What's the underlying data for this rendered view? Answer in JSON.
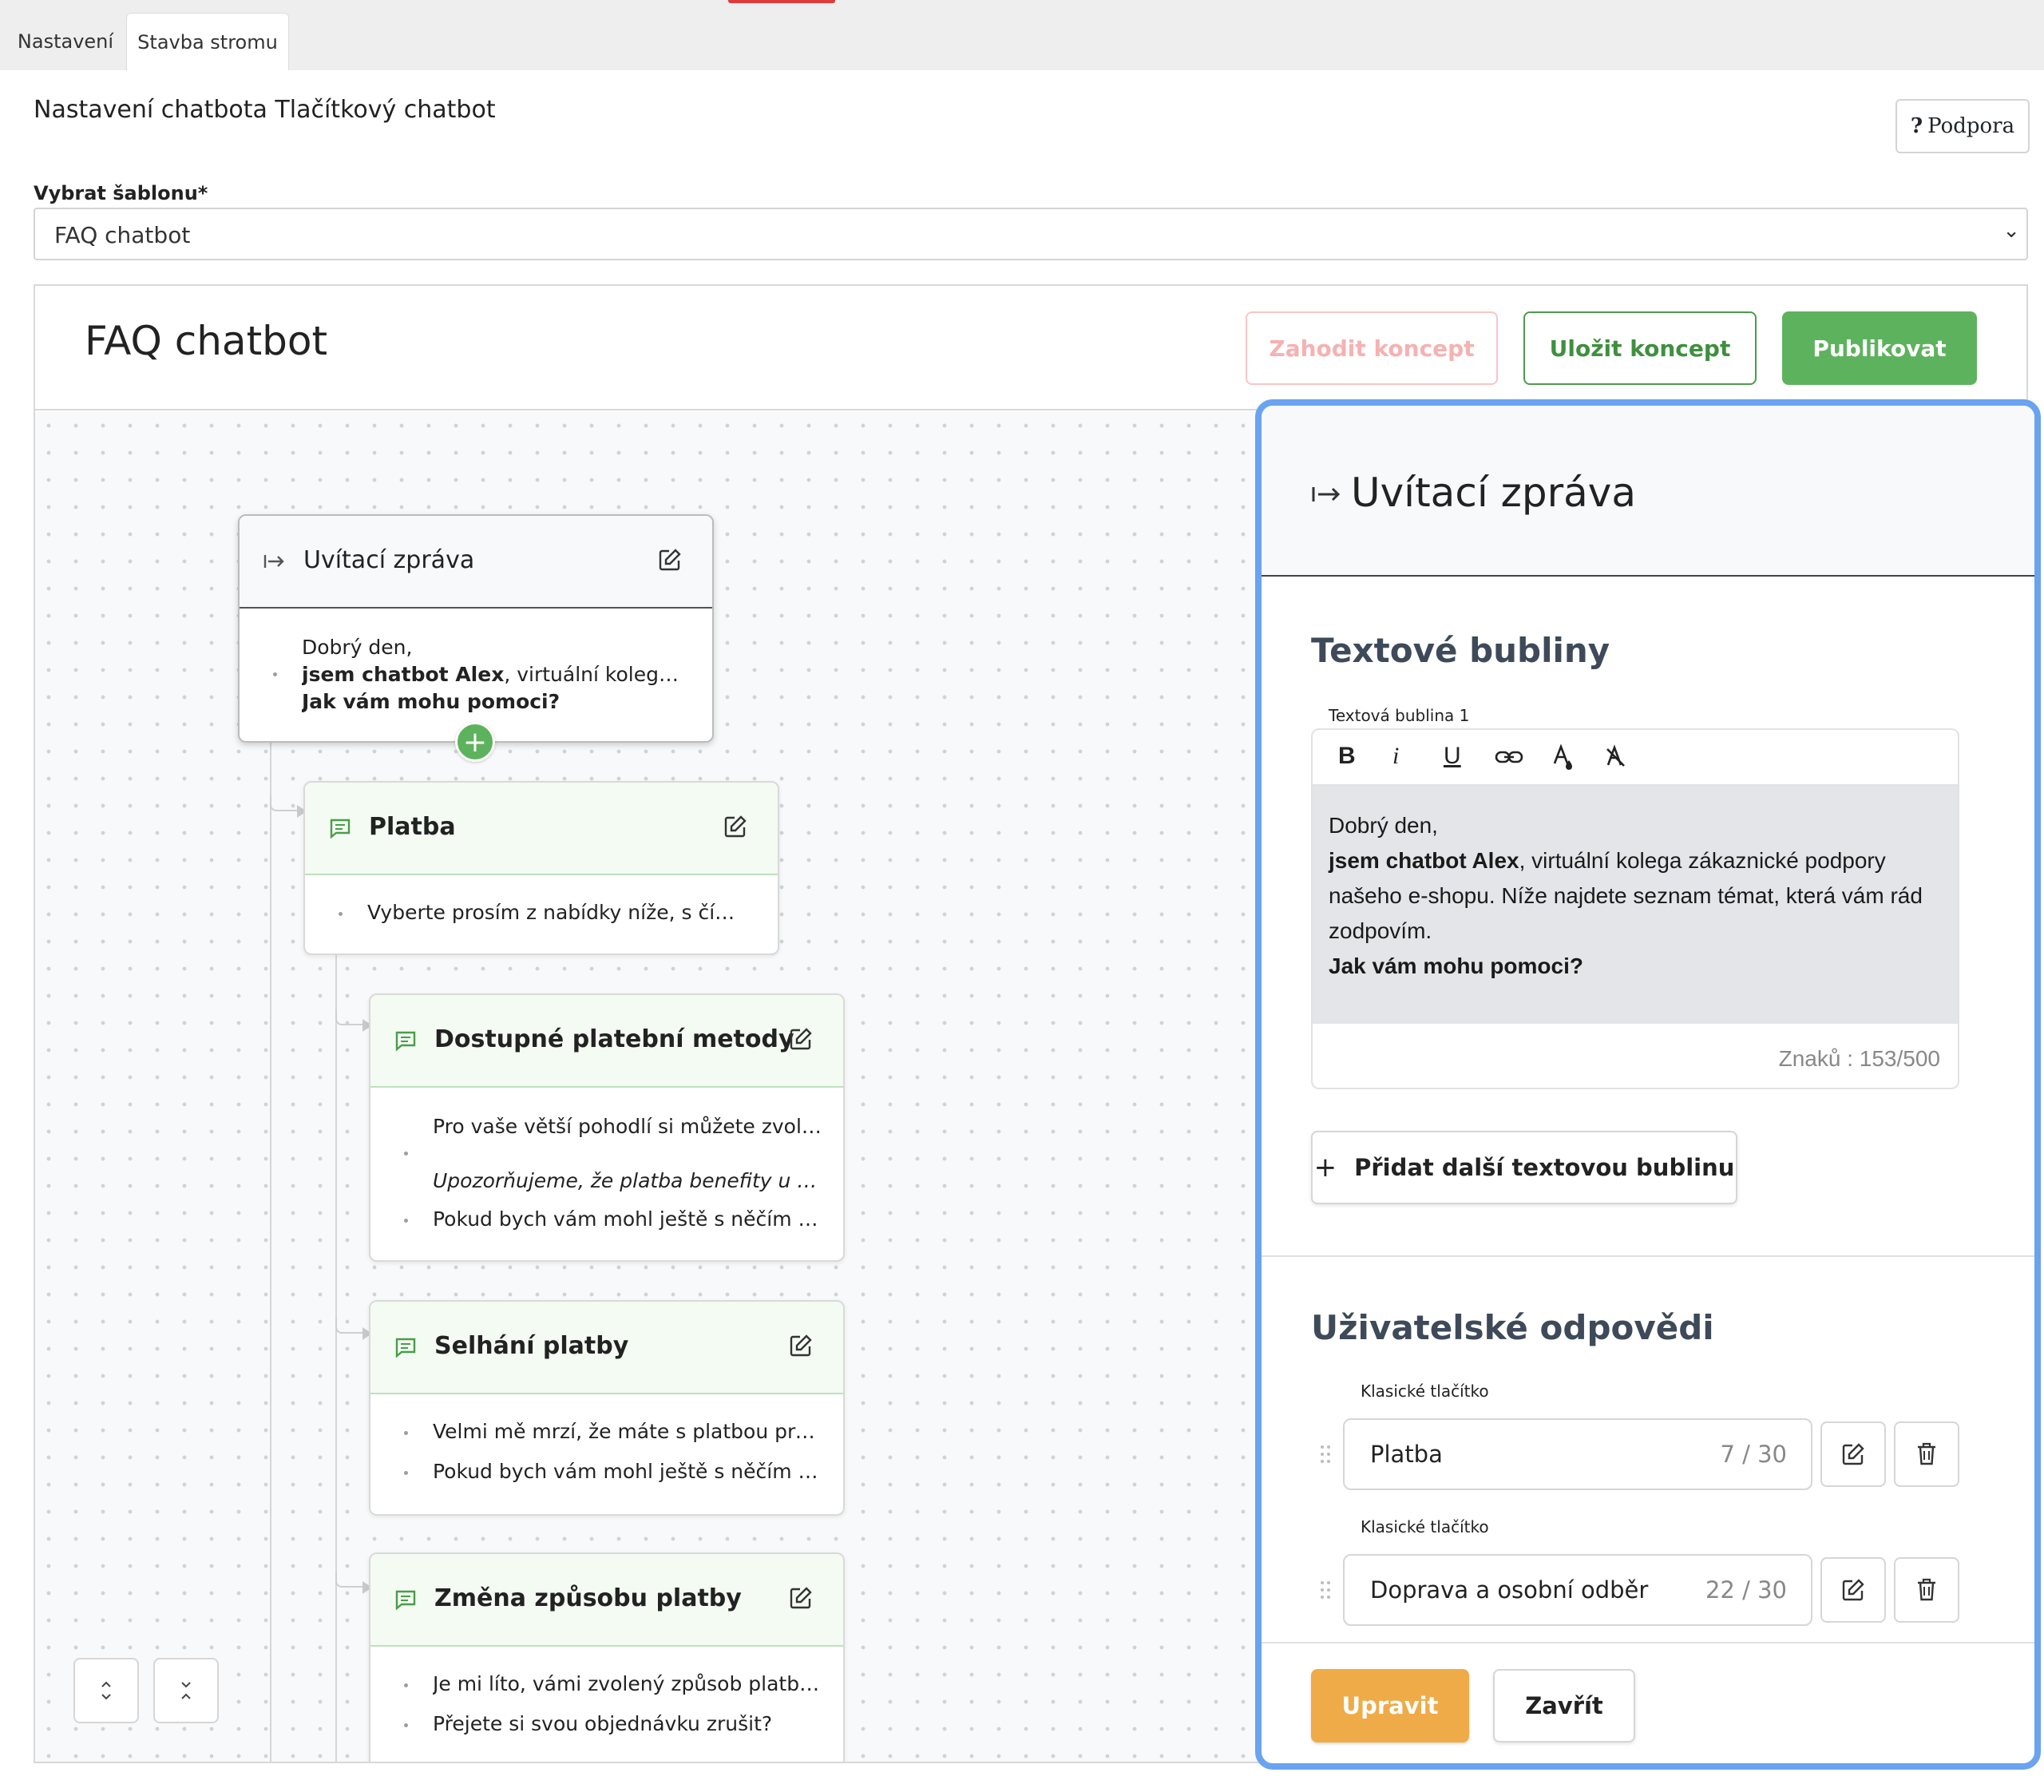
{
  "tabs": [
    {
      "label": "Nastavení"
    },
    {
      "label": "Stavba stromu"
    }
  ],
  "page": {
    "title": "Nastavení chatbota Tlačítkový chatbot",
    "support_label": "Podpora",
    "support_icon": "?"
  },
  "template": {
    "label": "Vybrat šablonu*",
    "value": "FAQ chatbot"
  },
  "editor_header": {
    "title": "FAQ chatbot",
    "discard_label": "Zahodit koncept",
    "save_label": "Uložit koncept",
    "publish_label": "Publikovat"
  },
  "tree": {
    "root": {
      "title": "Uvítací zpráva",
      "lines": [
        "Dobrý den,",
        "jsem chatbot Alex, virtuální kolega zákaz...",
        "Jak vám mohu pomoci?"
      ],
      "bold_prefix": "jsem chatbot Alex",
      "rest": ", virtuální kolega zákaz..."
    },
    "platba": {
      "title": "Platba",
      "lines": [
        "Vyberte prosím z nabídky níže, s čím konk..."
      ]
    },
    "children": [
      {
        "title": "Dostupné platební metody",
        "lines": [
          "Pro vaše větší pohodlí si můžete zvolit z ...",
          "Upozorňujeme, že platba benefity u nás n...",
          "Pokud bych vám mohl ještě s něčím pom..."
        ]
      },
      {
        "title": "Selhání platby",
        "lines": [
          "Velmi mě mrzí, že máte s platbou problé...",
          "Pokud bych vám mohl ještě s něčím pom..."
        ]
      },
      {
        "title": "Změna způsobu platby",
        "lines": [
          "Je mi líto, vámi zvolený způsob platby v o...",
          "Přejete si svou objednávku zrušit?"
        ]
      }
    ]
  },
  "panel": {
    "title": "Uvítací zpráva",
    "bubbles_title": "Textové bubliny",
    "bubble_label": "Textová bublina 1",
    "bubble_text": {
      "line1": "Dobrý den,",
      "bold": "jsem chatbot Alex",
      "line2_rest": ", virtuální kolega zákaznické podpory",
      "line3": "našeho e-shopu. Níže najdete seznam témat, která vám rád",
      "line4": "zodpovím.",
      "line5": "Jak vám mohu pomoci?"
    },
    "char_count": "Znaků : 153/500",
    "add_bubble_label": "Přidat další textovou bublinu",
    "answers_title": "Uživatelské odpovědi",
    "answers": [
      {
        "type": "Klasické tlačítko",
        "text": "Platba",
        "count": "7 / 30"
      },
      {
        "type": "Klasické tlačítko",
        "text": "Doprava a osobní odběr",
        "count": "22 / 30"
      }
    ],
    "edit_label": "Upravit",
    "close_label": "Zavřít"
  },
  "colors": {
    "green": "#5db35d",
    "orange": "#efab48",
    "panel_border": "#6aa3f0",
    "discard": "#f6b1b1"
  }
}
